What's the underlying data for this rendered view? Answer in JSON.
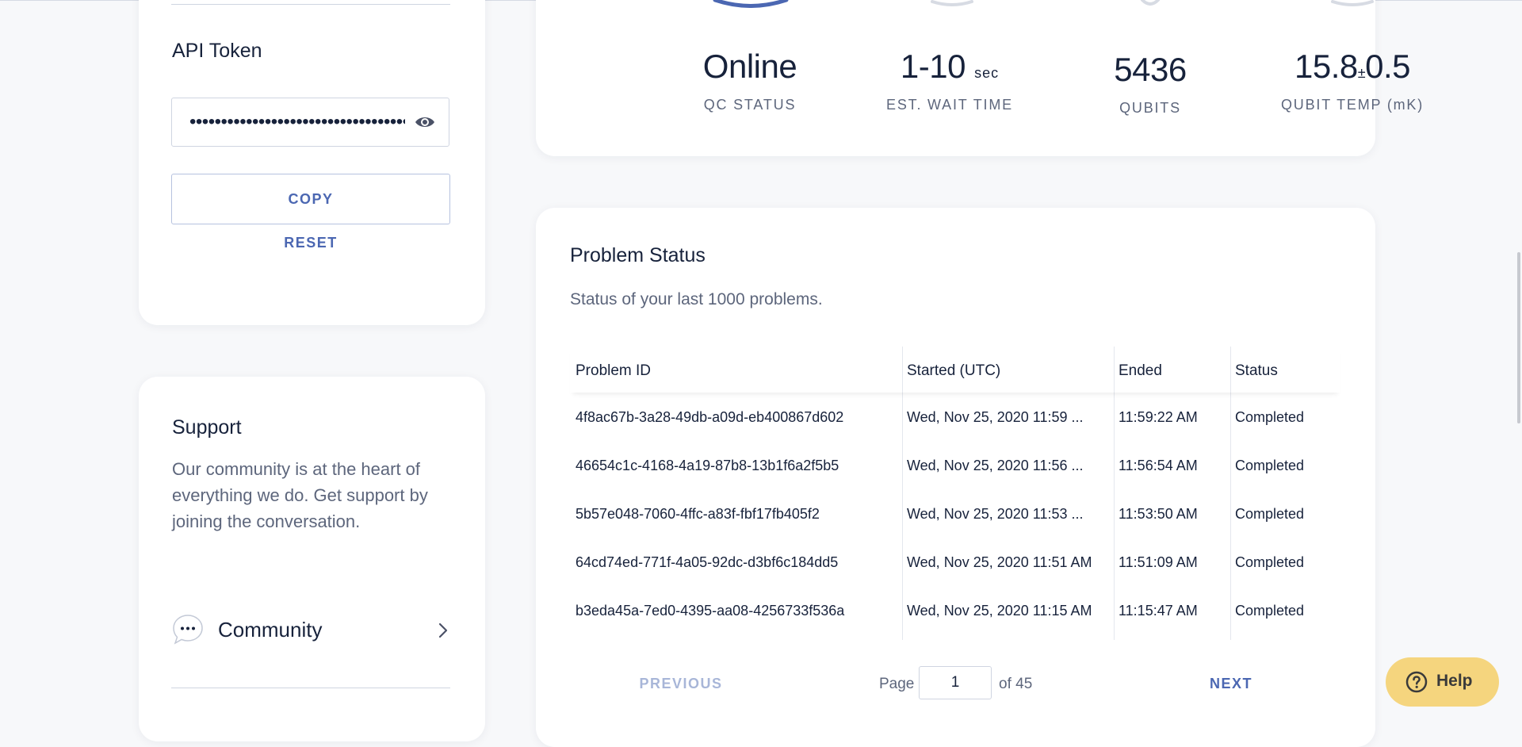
{
  "api_token": {
    "title": "API Token",
    "masked_value": "••••••••••••••••••••••••••••••••••••••",
    "copy_label": "COPY",
    "reset_label": "RESET"
  },
  "support": {
    "title": "Support",
    "description": "Our community is at the heart of everything we do. Get support by joining the conversation.",
    "community_label": "Community"
  },
  "stats": {
    "status": {
      "value": "Online",
      "label": "QC STATUS"
    },
    "wait": {
      "value": "1-10",
      "unit": "sec",
      "label": "EST. WAIT TIME"
    },
    "qubits": {
      "value": "5436",
      "label": "QUBITS"
    },
    "temp": {
      "value": "15.8",
      "pm": "±",
      "err": "0.5",
      "label": "QUBIT TEMP (mK)"
    }
  },
  "problems": {
    "title": "Problem Status",
    "subtitle": "Status of your last 1000 problems.",
    "headers": [
      "Problem ID",
      "Started (UTC)",
      "Ended",
      "Status"
    ],
    "rows": [
      [
        "4f8ac67b-3a28-49db-a09d-eb400867d602",
        "Wed, Nov 25, 2020 11:59 ...",
        "11:59:22 AM",
        "Completed"
      ],
      [
        "46654c1c-4168-4a19-87b8-13b1f6a2f5b5",
        "Wed, Nov 25, 2020 11:56 ...",
        "11:56:54 AM",
        "Completed"
      ],
      [
        "5b57e048-7060-4ffc-a83f-fbf17fb405f2",
        "Wed, Nov 25, 2020 11:53 ...",
        "11:53:50 AM",
        "Completed"
      ],
      [
        "64cd74ed-771f-4a05-92dc-d3bf6c184dd5",
        "Wed, Nov 25, 2020 11:51 AM",
        "11:51:09 AM",
        "Completed"
      ],
      [
        "b3eda45a-7ed0-4395-aa08-4256733f536a",
        "Wed, Nov 25, 2020 11:15 AM",
        "11:15:47 AM",
        "Completed"
      ]
    ]
  },
  "pagination": {
    "previous_label": "PREVIOUS",
    "page_label": "Page",
    "current_page": "1",
    "of_label": "of 45",
    "next_label": "NEXT"
  },
  "help": {
    "label": "Help"
  },
  "colors": {
    "accent": "#4b67b2",
    "gauge_blue": "#4b67b2",
    "help_bg": "#f5d57e",
    "text_dark": "#17223b",
    "text_muted": "#5d667c"
  }
}
